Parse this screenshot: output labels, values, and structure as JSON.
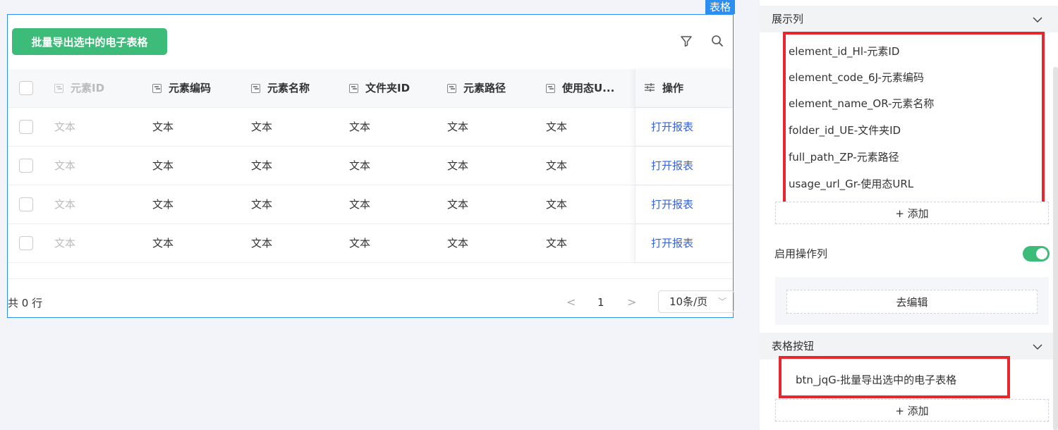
{
  "table": {
    "component_tag": "表格",
    "export_button": "批量导出选中的电子表格",
    "columns": [
      "元素ID",
      "元素编码",
      "元素名称",
      "文件夹ID",
      "元素路径",
      "使用态U..."
    ],
    "op_header": "操作",
    "rows": [
      {
        "cells": [
          "文本",
          "文本",
          "文本",
          "文本",
          "文本",
          "文本"
        ],
        "action": "打开报表"
      },
      {
        "cells": [
          "文本",
          "文本",
          "文本",
          "文本",
          "文本",
          "文本"
        ],
        "action": "打开报表"
      },
      {
        "cells": [
          "文本",
          "文本",
          "文本",
          "文本",
          "文本",
          "文本"
        ],
        "action": "打开报表"
      },
      {
        "cells": [
          "文本",
          "文本",
          "文本",
          "文本",
          "文本",
          "文本"
        ],
        "action": "打开报表"
      }
    ],
    "pagination": {
      "total": "共 0 行",
      "prev": "<",
      "page": "1",
      "next": ">",
      "page_size": "10条/页"
    }
  },
  "panel": {
    "display_columns": {
      "header": "展示列",
      "items": [
        "element_id_Hl-元素ID",
        "element_code_6J-元素编码",
        "element_name_OR-元素名称",
        "folder_id_UE-文件夹ID",
        "full_path_ZP-元素路径",
        "usage_url_Gr-使用态URL"
      ],
      "add_label": "+ 添加"
    },
    "enable_op_column": {
      "label": "启用操作列",
      "enabled": true,
      "edit_label": "去编辑"
    },
    "table_buttons": {
      "header": "表格按钮",
      "items": [
        "btn_jqG-批量导出选中的电子表格"
      ],
      "add_label": "+ 添加"
    }
  },
  "colors": {
    "primary_green": "#3dbb79",
    "selection_blue": "#2b8ef0",
    "highlight_red": "#e8262e",
    "link_blue": "#3a62d8"
  }
}
